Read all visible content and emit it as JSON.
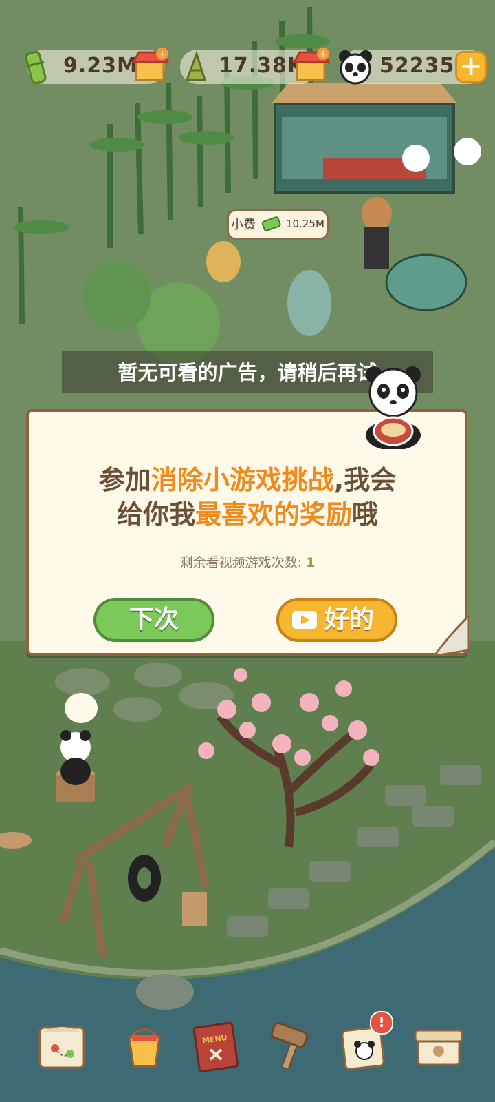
{
  "resources": {
    "bamboo": {
      "value": "9.23M",
      "icon": "bamboo-stalk-icon"
    },
    "shoots": {
      "value": "17.38K",
      "icon": "bamboo-shoot-icon"
    },
    "pandas": {
      "value": "52235",
      "icon": "panda-icon"
    },
    "add_label": "+"
  },
  "tip_bubble": {
    "label": "小费",
    "value": "10.25M",
    "icon": "cash-icon"
  },
  "toast": {
    "text": "暂无可看的广告，请稍后再试"
  },
  "dialog": {
    "message_parts": [
      "参加",
      "消除小游戏挑战",
      ",我会",
      "给你我",
      "最喜欢的奖励",
      "哦"
    ],
    "remain_label": "剩余看视频游戏次数:",
    "remain_count": "1",
    "next_button": "下次",
    "ok_button": "好的",
    "ok_icon": "video-play-icon"
  },
  "bottom_nav": {
    "items": [
      {
        "icon": "map-icon"
      },
      {
        "icon": "paint-bucket-icon"
      },
      {
        "icon": "menu-book-icon",
        "label": "MENU"
      },
      {
        "icon": "hammer-tools-icon"
      },
      {
        "icon": "panda-card-icon"
      },
      {
        "icon": "storage-box-icon"
      }
    ],
    "notification_badge": "!"
  },
  "colors": {
    "accent_orange": "#f08a1c",
    "button_green": "#7cc85a",
    "button_yellow": "#f6b62f",
    "dialog_bg": "#fff9ea"
  }
}
